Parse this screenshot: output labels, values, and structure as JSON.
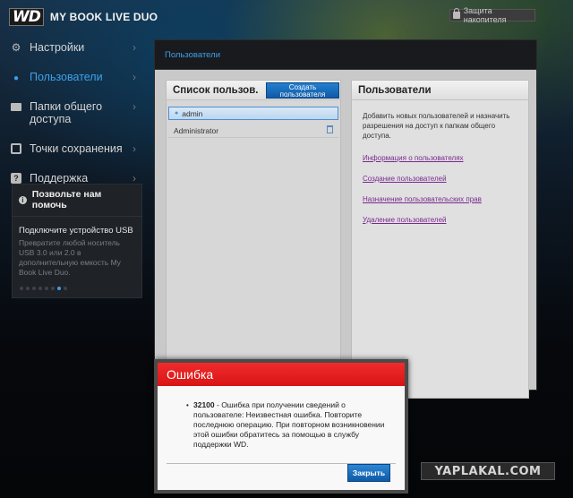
{
  "header": {
    "logo": "WD",
    "product": "MY BOOK LIVE DUO",
    "protect_button": "Защита накопителя"
  },
  "nav": {
    "items": [
      {
        "label": "Настройки",
        "icon": "gear-icon"
      },
      {
        "label": "Пользователи",
        "icon": "user-icon",
        "active": true
      },
      {
        "label": "Папки общего доступа",
        "icon": "folder-icon"
      },
      {
        "label": "Точки сохранения",
        "icon": "safepoint-icon"
      },
      {
        "label": "Поддержка",
        "icon": "help-icon"
      }
    ]
  },
  "help_box": {
    "title": "Позвольте нам помочь",
    "heading": "Подключите устройство USB",
    "text": "Превратите любой носитель USB 3.0 или 2.0 в дополнительную емкость My Book Live Duo.",
    "carousel_total": 8,
    "carousel_active": 7
  },
  "main": {
    "breadcrumb": "Пользователи",
    "user_list": {
      "title": "Список пользов.",
      "create_button": "Создать пользователя",
      "users": [
        "admin",
        "Administrator"
      ]
    },
    "details": {
      "title": "Пользователи",
      "description": "Добавить новых пользователей и назначить разрешения на доступ к папкам общего доступа.",
      "links": [
        "Информация о пользователях",
        "Создание пользователей",
        "Назначение пользовательских прав",
        "Удаление пользователей"
      ]
    }
  },
  "dialog": {
    "title": "Ошибка",
    "code": "32100",
    "message": " - Ошибка при получении сведений о пользователе: Неизвестная ошибка. Повторите последнюю операцию. При повторном возникновении этой ошибки обратитесь за помощью в службу поддержки WD.",
    "close_button": "Закрыть"
  },
  "watermark": "YAPLAKAL.COM",
  "colors": {
    "accent": "#3fa0ea",
    "error": "#e11f1f",
    "link": "#7a2a8f"
  }
}
